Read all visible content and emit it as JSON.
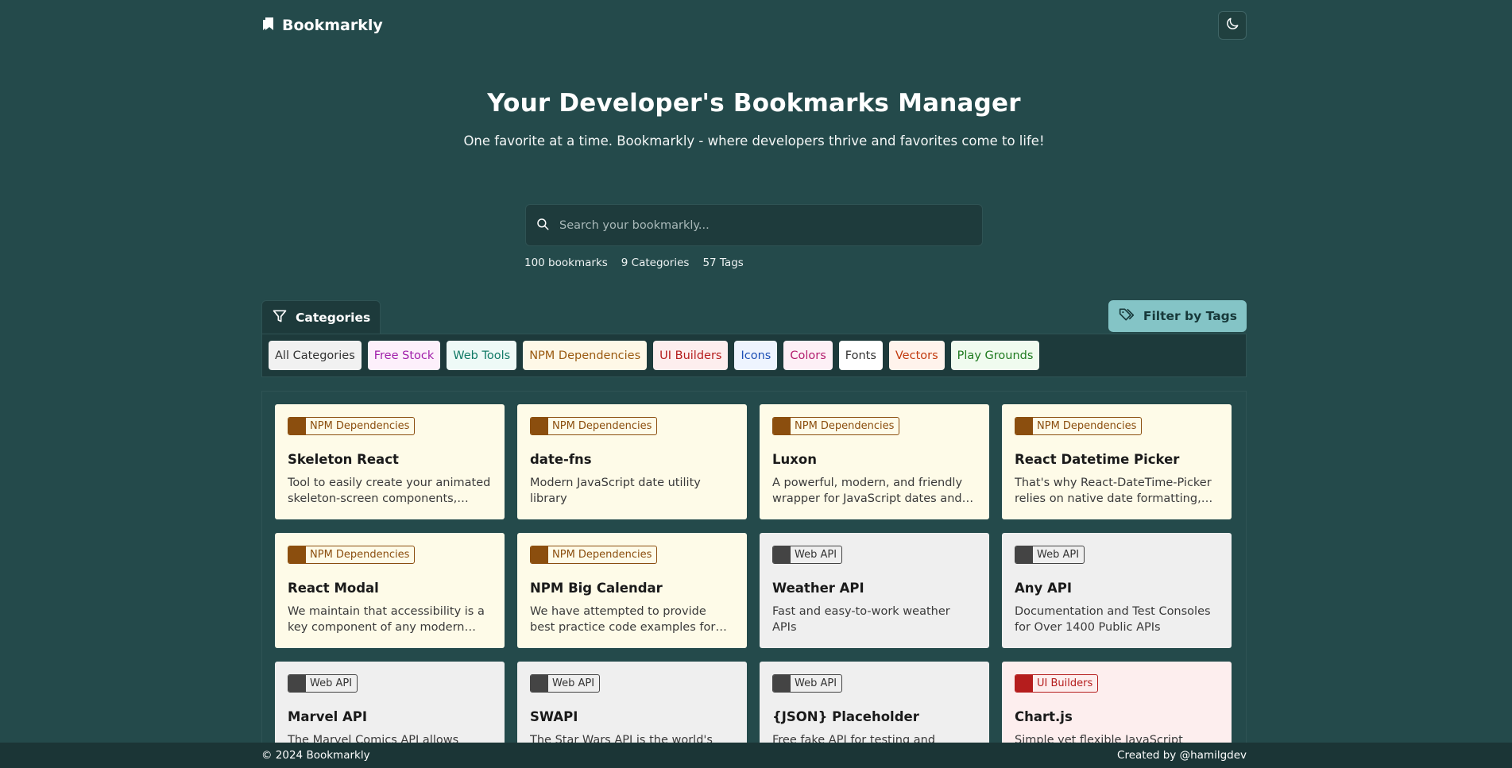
{
  "brand": {
    "name": "Bookmarkly"
  },
  "hero": {
    "title": "Your Developer's Bookmarks Manager",
    "subtitle": "One favorite at a time. Bookmarkly - where developers thrive and favorites come to life!"
  },
  "search": {
    "placeholder": "Search your bookmarkly..."
  },
  "stats": {
    "bookmarks": "100 bookmarks",
    "categories": "9 Categories",
    "tags": "57 Tags"
  },
  "categories": {
    "heading": "Categories",
    "filter_label": "Filter by Tags",
    "chips": [
      {
        "label": "All Categories",
        "bg": "#f1f1f1",
        "fg": "#333333"
      },
      {
        "label": "Free Stock",
        "bg": "#fdf0fb",
        "fg": "#a11faa"
      },
      {
        "label": "Web Tools",
        "bg": "#eefaf7",
        "fg": "#127a66"
      },
      {
        "label": "NPM Dependencies",
        "bg": "#fef8e7",
        "fg": "#9a5a10"
      },
      {
        "label": "UI Builders",
        "bg": "#fdeeee",
        "fg": "#b51d1d"
      },
      {
        "label": "Icons",
        "bg": "#eef4fe",
        "fg": "#1d4fb5"
      },
      {
        "label": "Colors",
        "bg": "#fdf0f6",
        "fg": "#b31d6e"
      },
      {
        "label": "Fonts",
        "bg": "#ffffff",
        "fg": "#333333"
      },
      {
        "label": "Vectors",
        "bg": "#fff3ec",
        "fg": "#c23a0e"
      },
      {
        "label": "Play Grounds",
        "bg": "#f0fbef",
        "fg": "#1f7a1f"
      }
    ]
  },
  "cards": [
    {
      "category": "NPM Dependencies",
      "kind": "npm",
      "title": "Skeleton React",
      "desc": "Tool to easily create your animated skeleton-screen components, placeholders and more"
    },
    {
      "category": "NPM Dependencies",
      "kind": "npm",
      "title": "date-fns",
      "desc": "Modern JavaScript date utility library"
    },
    {
      "category": "NPM Dependencies",
      "kind": "npm",
      "title": "Luxon",
      "desc": "A powerful, modern, and friendly wrapper for JavaScript dates and times"
    },
    {
      "category": "NPM Dependencies",
      "kind": "npm",
      "title": "React Datetime Picker",
      "desc": "That's why React-DateTime-Picker relies on native date formatting, and more"
    },
    {
      "category": "NPM Dependencies",
      "kind": "npm",
      "title": "React Modal",
      "desc": "We maintain that accessibility is a key component of any modern web app"
    },
    {
      "category": "NPM Dependencies",
      "kind": "npm",
      "title": "NPM Big Calendar",
      "desc": "We have attempted to provide best practice code examples for using the calendar"
    },
    {
      "category": "Web API",
      "kind": "api",
      "title": "Weather API",
      "desc": "Fast and easy-to-work weather APIs"
    },
    {
      "category": "Web API",
      "kind": "api",
      "title": "Any API",
      "desc": "Documentation and Test Consoles for Over 1400 Public APIs"
    },
    {
      "category": "Web API",
      "kind": "api",
      "title": "Marvel API",
      "desc": "The Marvel Comics API allows developers everywhere to access information"
    },
    {
      "category": "Web API",
      "kind": "api",
      "title": "SWAPI",
      "desc": "The Star Wars API is the world's first quantified and programmatically-formatted set of Star Wars data"
    },
    {
      "category": "Web API",
      "kind": "api",
      "title": "{JSON} Placeholder",
      "desc": "Free fake API for testing and prototyping"
    },
    {
      "category": "UI Builders",
      "kind": "ui",
      "title": "Chart.js",
      "desc": "Simple yet flexible JavaScript charting for designers and developers"
    }
  ],
  "footer": {
    "copyright": "© 2024 Bookmarkly",
    "credit": "Created by @hamilgdev"
  }
}
